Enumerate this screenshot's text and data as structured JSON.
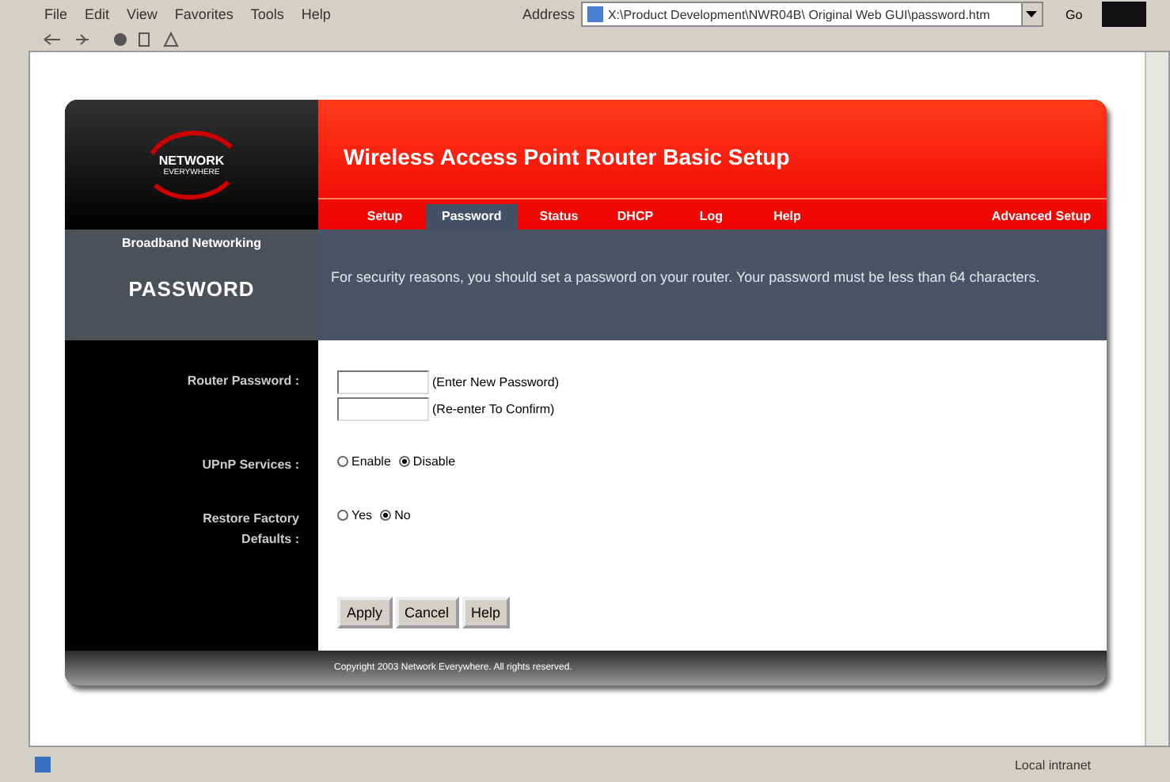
{
  "browser": {
    "menu": [
      "File",
      "Edit",
      "View",
      "Favorites",
      "Tools",
      "Help"
    ],
    "address_label": "Address",
    "address": "X:\\Product Development\\NWR04B\\ Original Web GUI\\password.htm",
    "go": "Go"
  },
  "router": {
    "logo": [
      "NETWORK",
      "EVERYWHERE"
    ],
    "title": "Wireless Access Point Router Basic Setup",
    "tabs": [
      {
        "label": "Setup",
        "selected": false
      },
      {
        "label": "Password",
        "selected": true
      },
      {
        "label": "Status",
        "selected": false
      },
      {
        "label": "DHCP",
        "selected": false
      },
      {
        "label": "Log",
        "selected": false
      },
      {
        "label": "Help",
        "selected": false
      }
    ],
    "advanced": "Advanced Setup",
    "section_caption": "Broadband Networking",
    "section": "PASSWORD",
    "intro": "For security reasons, you should set a password on your router. Your password must be less than 64 characters.",
    "password_label": "Router Password :",
    "password_hints": [
      "(Enter New Password)",
      "(Re-enter To Confirm)"
    ],
    "options": [
      {
        "label": "UPnP Services :",
        "choices": [
          {
            "label": "Enable",
            "selected": false
          },
          {
            "label": "Disable",
            "selected": true
          }
        ]
      },
      {
        "label": "Restore Factory Defaults :",
        "choices": [
          {
            "label": "Yes",
            "selected": false
          },
          {
            "label": "No",
            "selected": true
          }
        ]
      }
    ],
    "buttons": [
      "Apply",
      "Cancel",
      "Help"
    ],
    "footer": "Copyright 2003 Network Everywhere. All rights reserved."
  },
  "status_bar": {
    "zone": "Local intranet"
  }
}
